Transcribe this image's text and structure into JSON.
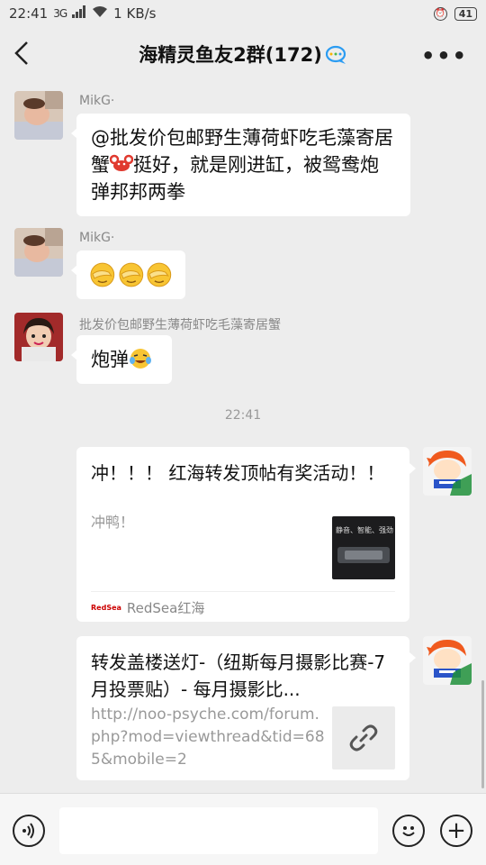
{
  "status_bar": {
    "time": "22:41",
    "network": "3G",
    "speed": "1 KB/s",
    "battery": "41"
  },
  "header": {
    "title": "海精灵鱼友2群(172)",
    "back_icon": "chevron-left-icon",
    "more_icon": "more-dots-icon",
    "more_label": "•••"
  },
  "messages": [
    {
      "sender": "MikG·",
      "text": "@批发价包邮野生薄荷虾吃毛藻寄居蟹",
      "text_after_emoji": "挺好，就是刚进缸，被鸳鸯炮弹邦邦两拳"
    },
    {
      "sender": "MikG·",
      "emoji": "[捂脸]"
    },
    {
      "sender": "批发价包邮野生薄荷虾吃毛藻寄居蟹",
      "text": "炮弹"
    }
  ],
  "timestamp": "22:41",
  "cards": [
    {
      "title": "冲！！！ 红海转发顶帖有奖活动！！",
      "desc": "冲鸭！",
      "thumb_text": "静音、智能、强劲",
      "source": "RedSea红海",
      "source_logo": "RedSea"
    },
    {
      "title": "转发盖楼送灯-（纽斯每月摄影比赛-7月投票贴）- 每月摄影比...",
      "desc": "http://noo-psyche.com/forum.php?mod=viewthread&tid=685&mobile=2",
      "thumb_icon": "link-icon"
    }
  ],
  "bottom_bar": {
    "voice_icon": "voice-icon",
    "emoji_icon": "smiley-icon",
    "add_icon": "plus-icon",
    "add_label": "+"
  },
  "colors": {
    "background": "#ededed",
    "bubble": "#ffffff",
    "accent_red": "#cc0000"
  }
}
